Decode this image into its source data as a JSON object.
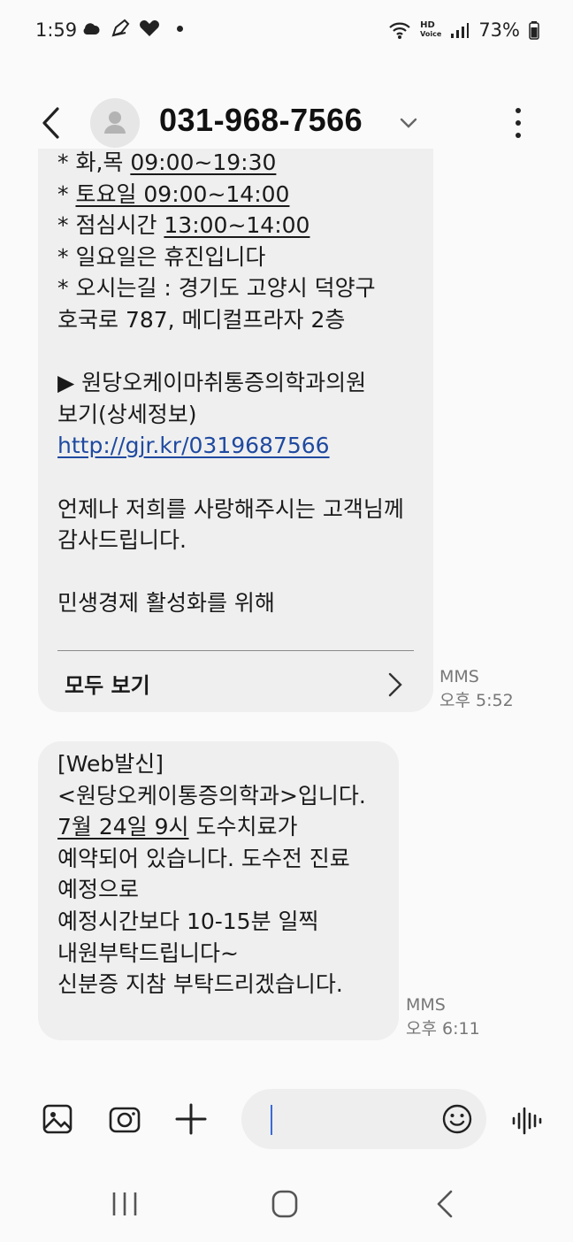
{
  "status": {
    "time": "1:59",
    "battery": "73%",
    "hd": "HD",
    "voice": "Voice"
  },
  "header": {
    "title": "031-968-7566"
  },
  "message1": {
    "lines": [
      [
        "* 화,목 ",
        "09:00~19:30"
      ],
      [
        "* ",
        "토요일  09:00~14:00"
      ],
      [
        "* 점심시간  ",
        "13:00~14:00"
      ],
      [
        "* 일요일은 휴진입니다",
        ""
      ],
      [
        "* 오시는길 : 경기도 고양시 덕양구",
        ""
      ],
      [
        "호국로 787, 메디컬프라자 2층",
        ""
      ]
    ],
    "line7": "▶  원당오케이마취통증의학과의원",
    "line8": "보기(상세정보)",
    "link": "http://gjr.kr/0319687566",
    "line10": "언제나 저희를 사랑해주시는 고객님께",
    "line11": "감사드립니다.",
    "line12": "민생경제 활성화를 위해",
    "view_all": "모두 보기",
    "type": "MMS",
    "time": "오후 5:52"
  },
  "message2": {
    "line1": "[Web발신]",
    "line2": "<원당오케이통증의학과>입니다.",
    "line3_underlined": "7월 24일 9시",
    "line3_rest": " 도수치료가",
    "line4": "예약되어 있습니다. 도수전 진료",
    "line5": "예정으로",
    "line6": "예정시간보다 10-15분 일찍",
    "line7": "내원부탁드립니다~",
    "line8": "신분증 지참 부탁드리겠습니다.",
    "type": "MMS",
    "time": "오후 6:11"
  }
}
